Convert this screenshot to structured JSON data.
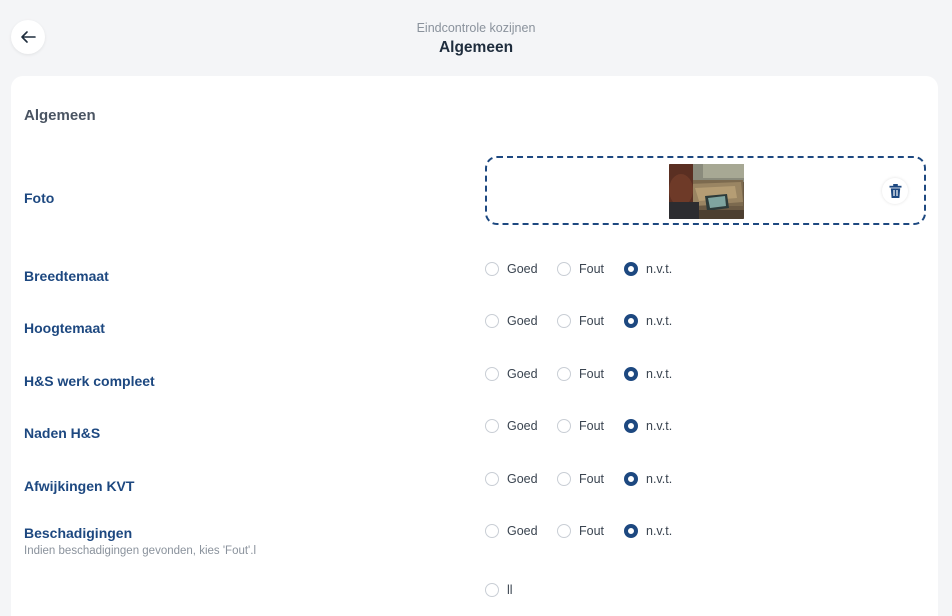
{
  "header": {
    "subtitle": "Eindcontrole kozijnen",
    "title": "Algemeen"
  },
  "section": {
    "title": "Algemeen"
  },
  "photo": {
    "label": "Foto"
  },
  "options": [
    "Goed",
    "Fout",
    "n.v.t."
  ],
  "rows": [
    {
      "label": "Breedtemaat",
      "hint": "",
      "selected": "n.v.t."
    },
    {
      "label": "Hoogtemaat",
      "hint": "",
      "selected": "n.v.t."
    },
    {
      "label": "H&S werk compleet",
      "hint": "",
      "selected": "n.v.t."
    },
    {
      "label": "Naden H&S",
      "hint": "",
      "selected": "n.v.t."
    },
    {
      "label": "Afwijkingen KVT",
      "hint": "",
      "selected": "n.v.t."
    },
    {
      "label": "Beschadigingen",
      "hint": "Indien beschadigingen gevonden, kies 'Fout'.l",
      "selected": "n.v.t."
    }
  ],
  "extra_option": {
    "label": "ll",
    "selected": false
  },
  "colors": {
    "accent": "#1d4880",
    "background": "#f4f5f7",
    "card": "#ffffff"
  },
  "icons": {
    "back": "arrow-left-icon",
    "delete": "trash-icon"
  }
}
